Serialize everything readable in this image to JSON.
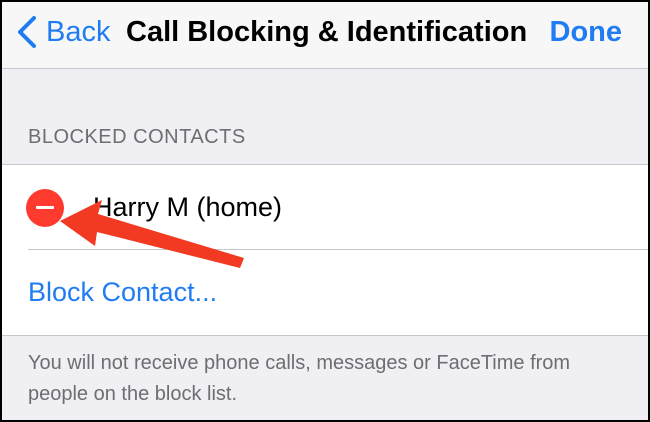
{
  "navbar": {
    "back_label": "Back",
    "title": "Call Blocking & Identification",
    "done_label": "Done"
  },
  "section": {
    "header": "BLOCKED CONTACTS",
    "contacts": [
      {
        "name": "Harry M (home)"
      }
    ],
    "block_contact_label": "Block Contact...",
    "footer": "You will not receive phone calls, messages or FaceTime from people on the block list."
  },
  "colors": {
    "accent": "#1f7cf2",
    "delete": "#ff3b30",
    "annotation_arrow": "#f23a22",
    "background": "#efeff4"
  },
  "icons": {
    "back": "chevron-left-icon",
    "delete": "minus-circle-icon",
    "annotation": "red-arrow-icon"
  }
}
